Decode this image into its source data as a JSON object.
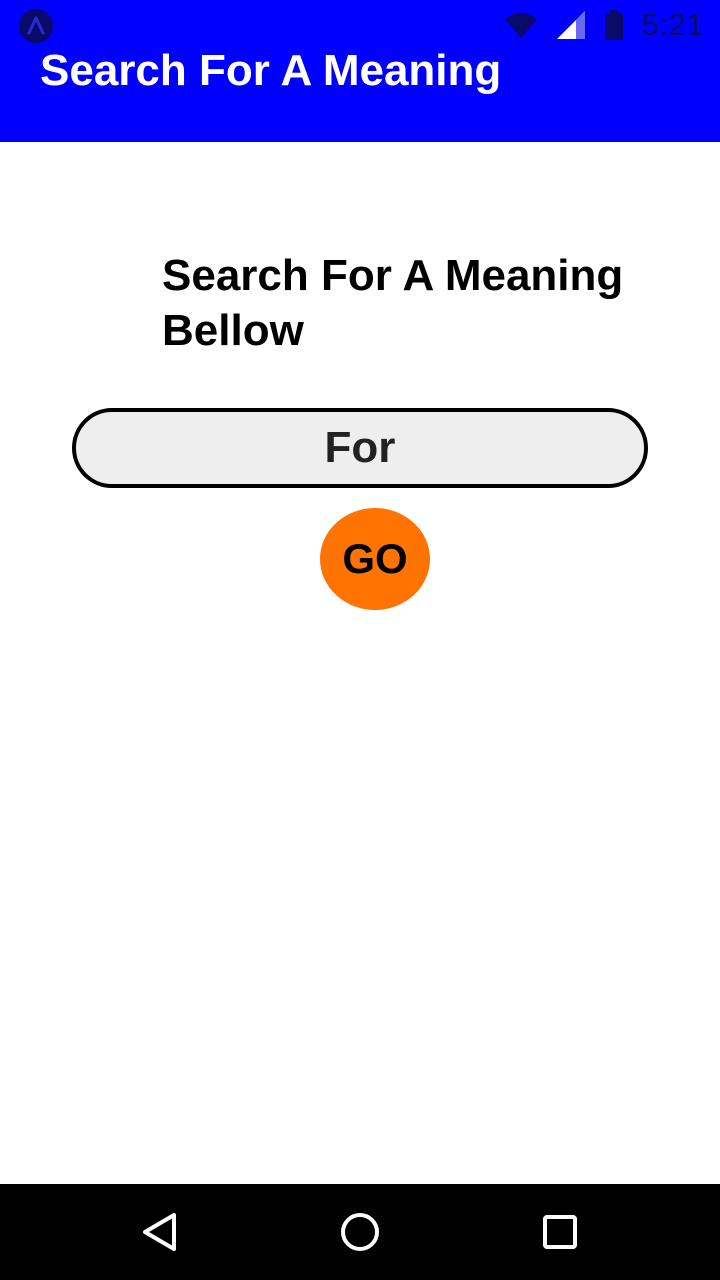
{
  "status_bar": {
    "time": "5:21",
    "icons": [
      "app-notification-icon",
      "wifi-icon",
      "cellular-signal-icon",
      "battery-icon"
    ]
  },
  "app_bar": {
    "title": "Search For A Meaning",
    "color": "#0000ff"
  },
  "main": {
    "heading": "Search For A Meaning Bellow",
    "search_input": {
      "value": "For",
      "background": "#eeeeee"
    },
    "go_button": {
      "label": "GO",
      "color": "#ff7300"
    }
  },
  "nav_bar": {
    "buttons": [
      "back-icon",
      "home-icon",
      "recents-icon"
    ]
  }
}
